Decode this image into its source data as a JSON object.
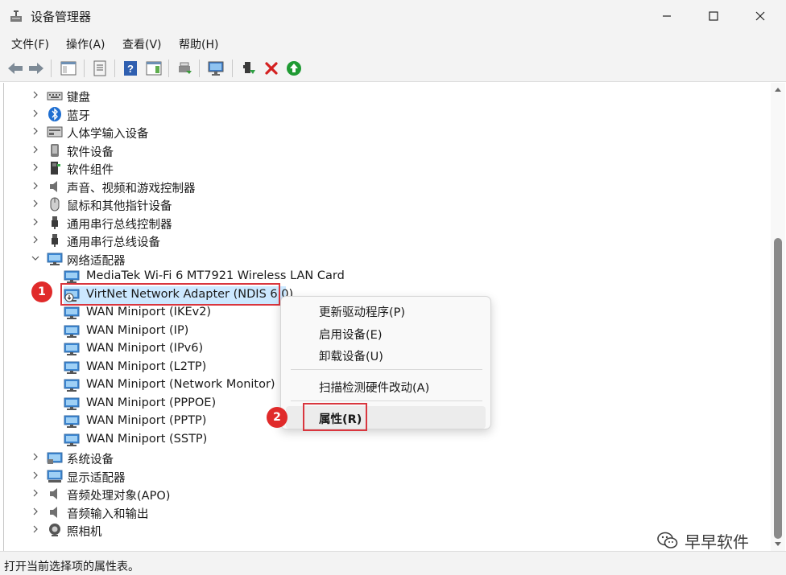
{
  "window": {
    "title": "设备管理器"
  },
  "menu": {
    "file": "文件(F)",
    "action": "操作(A)",
    "view": "查看(V)",
    "help": "帮助(H)"
  },
  "tree": {
    "cat_keyboard": "键盘",
    "cat_bluetooth": "蓝牙",
    "cat_hid": "人体学输入设备",
    "cat_software_dev": "软件设备",
    "cat_software_comp": "软件组件",
    "cat_sound": "声音、视频和游戏控制器",
    "cat_mouse": "鼠标和其他指针设备",
    "cat_usb_ctrl": "通用串行总线控制器",
    "cat_usb_dev": "通用串行总线设备",
    "cat_network": "网络适配器",
    "net_mediatek": "MediaTek Wi-Fi 6 MT7921 Wireless LAN Card",
    "net_virtnet": "VirtNet Network Adapter (NDIS 6.0)",
    "net_ikev2": "WAN Miniport (IKEv2)",
    "net_ip": "WAN Miniport (IP)",
    "net_ipv6": "WAN Miniport (IPv6)",
    "net_l2tp": "WAN Miniport (L2TP)",
    "net_netmon": "WAN Miniport (Network Monitor)",
    "net_pppoe": "WAN Miniport (PPPOE)",
    "net_pptp": "WAN Miniport (PPTP)",
    "net_sstp": "WAN Miniport (SSTP)",
    "cat_system": "系统设备",
    "cat_display": "显示适配器",
    "cat_apo": "音频处理对象(APO)",
    "cat_audio_io": "音频输入和输出",
    "cat_camera": "照相机"
  },
  "context_menu": {
    "update_driver": "更新驱动程序(P)",
    "enable_device": "启用设备(E)",
    "uninstall_device": "卸载设备(U)",
    "scan_hardware": "扫描检测硬件改动(A)",
    "properties": "属性(R)"
  },
  "annotations": {
    "step1": "1",
    "step2": "2"
  },
  "status_bar": {
    "text": "打开当前选择项的属性表。"
  },
  "watermark": {
    "text": "早早软件"
  },
  "colors": {
    "annotation_red": "#d9363e",
    "selection": "#cce8ff",
    "scroll_thumb": "#8a8a8a"
  }
}
